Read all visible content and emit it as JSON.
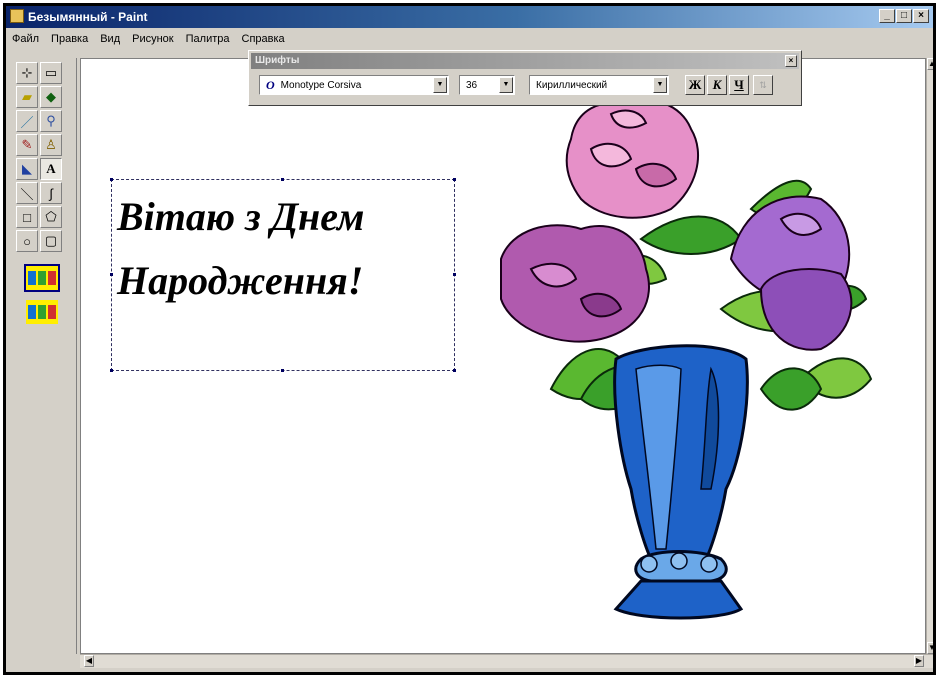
{
  "window": {
    "title": "Безымянный - Paint",
    "controls": {
      "minimize": "_",
      "maximize": "□",
      "close": "×"
    }
  },
  "menu": [
    "Файл",
    "Правка",
    "Вид",
    "Рисунок",
    "Палитра",
    "Справка"
  ],
  "fonts_toolbar": {
    "title": "Шрифты",
    "font_name": "Monotype Corsiva",
    "font_glyph": "O",
    "size": "36",
    "script": "Кириллический",
    "bold": "Ж",
    "italic": "К",
    "underline": "Ч"
  },
  "canvas_text": {
    "line1": "Вітаю з Днем",
    "line2": "Народження!"
  },
  "colors": {
    "title_active": "#0a246a",
    "face": "#d4d0c8",
    "vase": "#1e62c8",
    "flower_pink": "#e88cc4",
    "flower_purple": "#a14fb0",
    "leaf": "#3aa02a"
  },
  "tools": [
    "free-select",
    "rect-select",
    "eraser",
    "fill",
    "picker",
    "magnifier",
    "pencil",
    "brush",
    "airbrush",
    "text",
    "line",
    "curve",
    "rectangle",
    "polygon",
    "ellipse",
    "rounded-rect"
  ]
}
